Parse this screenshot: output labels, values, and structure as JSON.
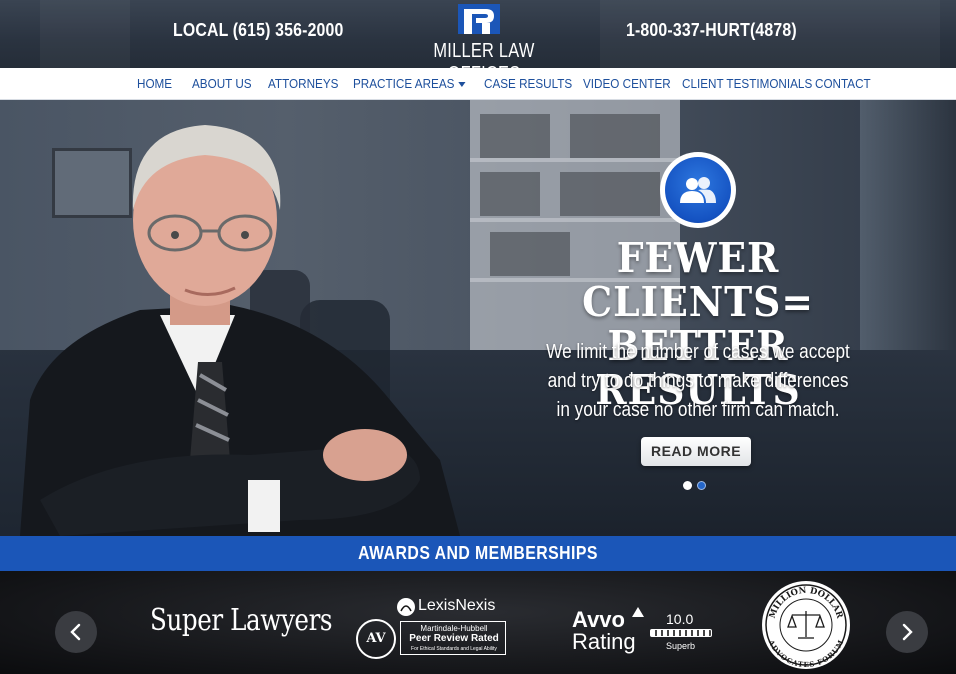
{
  "header": {
    "phone_local": "LOCAL (615) 356-2000",
    "phone_tollfree": "1-800-337-HURT(4878)",
    "logo_text": "MILLER LAW OFFICES"
  },
  "nav": {
    "items": [
      {
        "label": "HOME"
      },
      {
        "label": "ABOUT US"
      },
      {
        "label": "ATTORNEYS"
      },
      {
        "label": "PRACTICE AREAS"
      },
      {
        "label": "CASE RESULTS"
      },
      {
        "label": "VIDEO CENTER"
      },
      {
        "label": "CLIENT TESTIMONIALS"
      },
      {
        "label": "CONTACT"
      }
    ]
  },
  "hero": {
    "icon": "people-icon",
    "headline_line1": "FEWER CLIENTS=",
    "headline_line2": "BETTER RESULTS",
    "subtext_line1": "We limit the number of cases we accept",
    "subtext_line2": "and try to do things to make differences",
    "subtext_line3": "in your case no other firm can match.",
    "button_label": "READ MORE",
    "slide_count": 2,
    "active_slide": 1
  },
  "awards": {
    "title": "AWARDS AND MEMBERSHIPS",
    "super_lawyers": "Super Lawyers",
    "lexisnexis": {
      "brand": "LexisNexis",
      "badge": "AV",
      "line1": "Martindale-Hubbell",
      "line2": "Peer Review Rated",
      "line3": "For Ethical Standards and Legal Ability"
    },
    "avvo": {
      "name": "Avvo",
      "label": "Rating",
      "score": "10.0",
      "grade": "Superb",
      "score_fraction": 1.0
    },
    "million_dollar": {
      "top": "MILLION DOLLAR",
      "bottom": "ADVOCATES FORUM"
    }
  },
  "colors": {
    "nav_text": "#1d4f9c",
    "awards_bar": "#1b56b8",
    "icon_blue": "#1553c2"
  }
}
